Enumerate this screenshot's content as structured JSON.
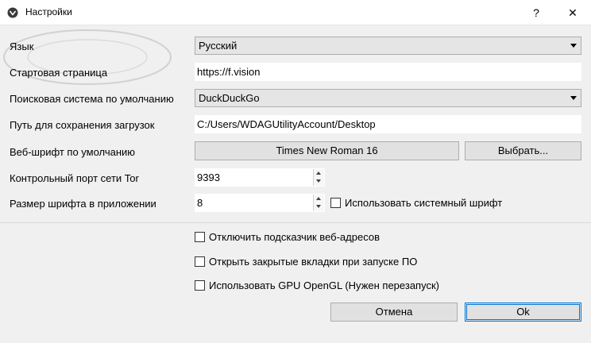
{
  "window": {
    "title": "Настройки",
    "help_glyph": "?",
    "close_glyph": "✕"
  },
  "rows": {
    "language": {
      "label": "Язык",
      "value": "Русский"
    },
    "start_page": {
      "label": "Стартовая страница",
      "value": "https://f.vision"
    },
    "search_engine": {
      "label": "Поисковая система по умолчанию",
      "value": "DuckDuckGo"
    },
    "download_path": {
      "label": "Путь для сохранения загрузок",
      "value": "C:/Users/WDAGUtilityAccount/Desktop"
    },
    "web_font": {
      "label": "Веб-шрифт по умолчанию",
      "value": "Times New Roman 16",
      "choose_label": "Выбрать..."
    },
    "tor_port": {
      "label": "Контрольный порт сети Tor",
      "value": "9393"
    },
    "font_size": {
      "label": "Размер шрифта в приложении",
      "value": "8",
      "system_font_label": "Использовать системный шрифт"
    }
  },
  "options": {
    "url_autocomplete_off": "Отключить подсказчик веб-адресов",
    "reopen_tabs": "Открыть закрытые вкладки при запуске ПО",
    "gpu_opengl": "Использовать GPU OpenGL (Нужен перезапуск)"
  },
  "buttons": {
    "cancel": "Отмена",
    "ok": "Ok"
  },
  "colors": {
    "accent": "#0078d7",
    "background": "#f0f0f0"
  }
}
